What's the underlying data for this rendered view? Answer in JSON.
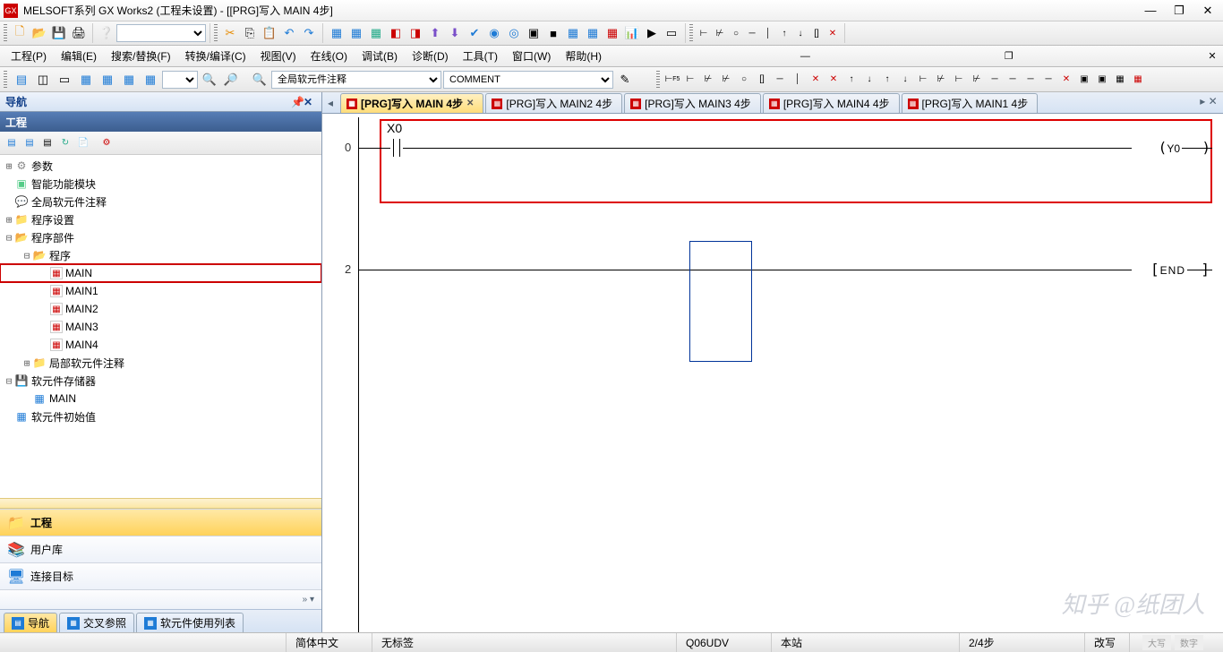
{
  "titlebar": {
    "title": "MELSOFT系列 GX Works2 (工程未设置) - [[PRG]写入 MAIN 4步]"
  },
  "menu": {
    "project": "工程(P)",
    "edit": "编辑(E)",
    "search": "搜索/替换(F)",
    "convert": "转换/编译(C)",
    "view": "视图(V)",
    "online": "在线(O)",
    "debug": "调试(B)",
    "diagnose": "诊断(D)",
    "tools": "工具(T)",
    "window": "窗口(W)",
    "help": "帮助(H)"
  },
  "toolbar2": {
    "globalComment": "全局软元件注释",
    "comment": "COMMENT"
  },
  "nav": {
    "title": "导航",
    "subtitle": "工程",
    "tree": {
      "params": "参数",
      "smartModule": "智能功能模块",
      "globalDevComment": "全局软元件注释",
      "progSettings": "程序设置",
      "progParts": "程序部件",
      "program": "程序",
      "main": "MAIN",
      "main1": "MAIN1",
      "main2": "MAIN2",
      "main3": "MAIN3",
      "main4": "MAIN4",
      "localDevComment": "局部软元件注释",
      "devStorage": "软元件存储器",
      "devStorageMain": "MAIN",
      "devInitial": "软元件初始值"
    },
    "buttons": {
      "project": "工程",
      "userlib": "用户库",
      "connection": "连接目标"
    },
    "tabs": {
      "nav": "导航",
      "xref": "交叉参照",
      "devuse": "软元件使用列表"
    }
  },
  "tabs": [
    {
      "label": "[PRG]写入 MAIN 4步",
      "active": true
    },
    {
      "label": "[PRG]写入 MAIN2 4步",
      "active": false
    },
    {
      "label": "[PRG]写入 MAIN3 4步",
      "active": false
    },
    {
      "label": "[PRG]写入 MAIN4 4步",
      "active": false
    },
    {
      "label": "[PRG]写入 MAIN1 4步",
      "active": false
    }
  ],
  "ladder": {
    "step0": "0",
    "step2": "2",
    "x0": "X0",
    "y0": "Y0",
    "end": "END"
  },
  "status": {
    "lang": "简体中文",
    "tag": "无标签",
    "cpu": "Q06UDV",
    "station": "本站",
    "step": "2/4步",
    "overwrite": "改写",
    "caps": "大写",
    "num": "数字"
  },
  "watermark": "知乎 @纸团人"
}
